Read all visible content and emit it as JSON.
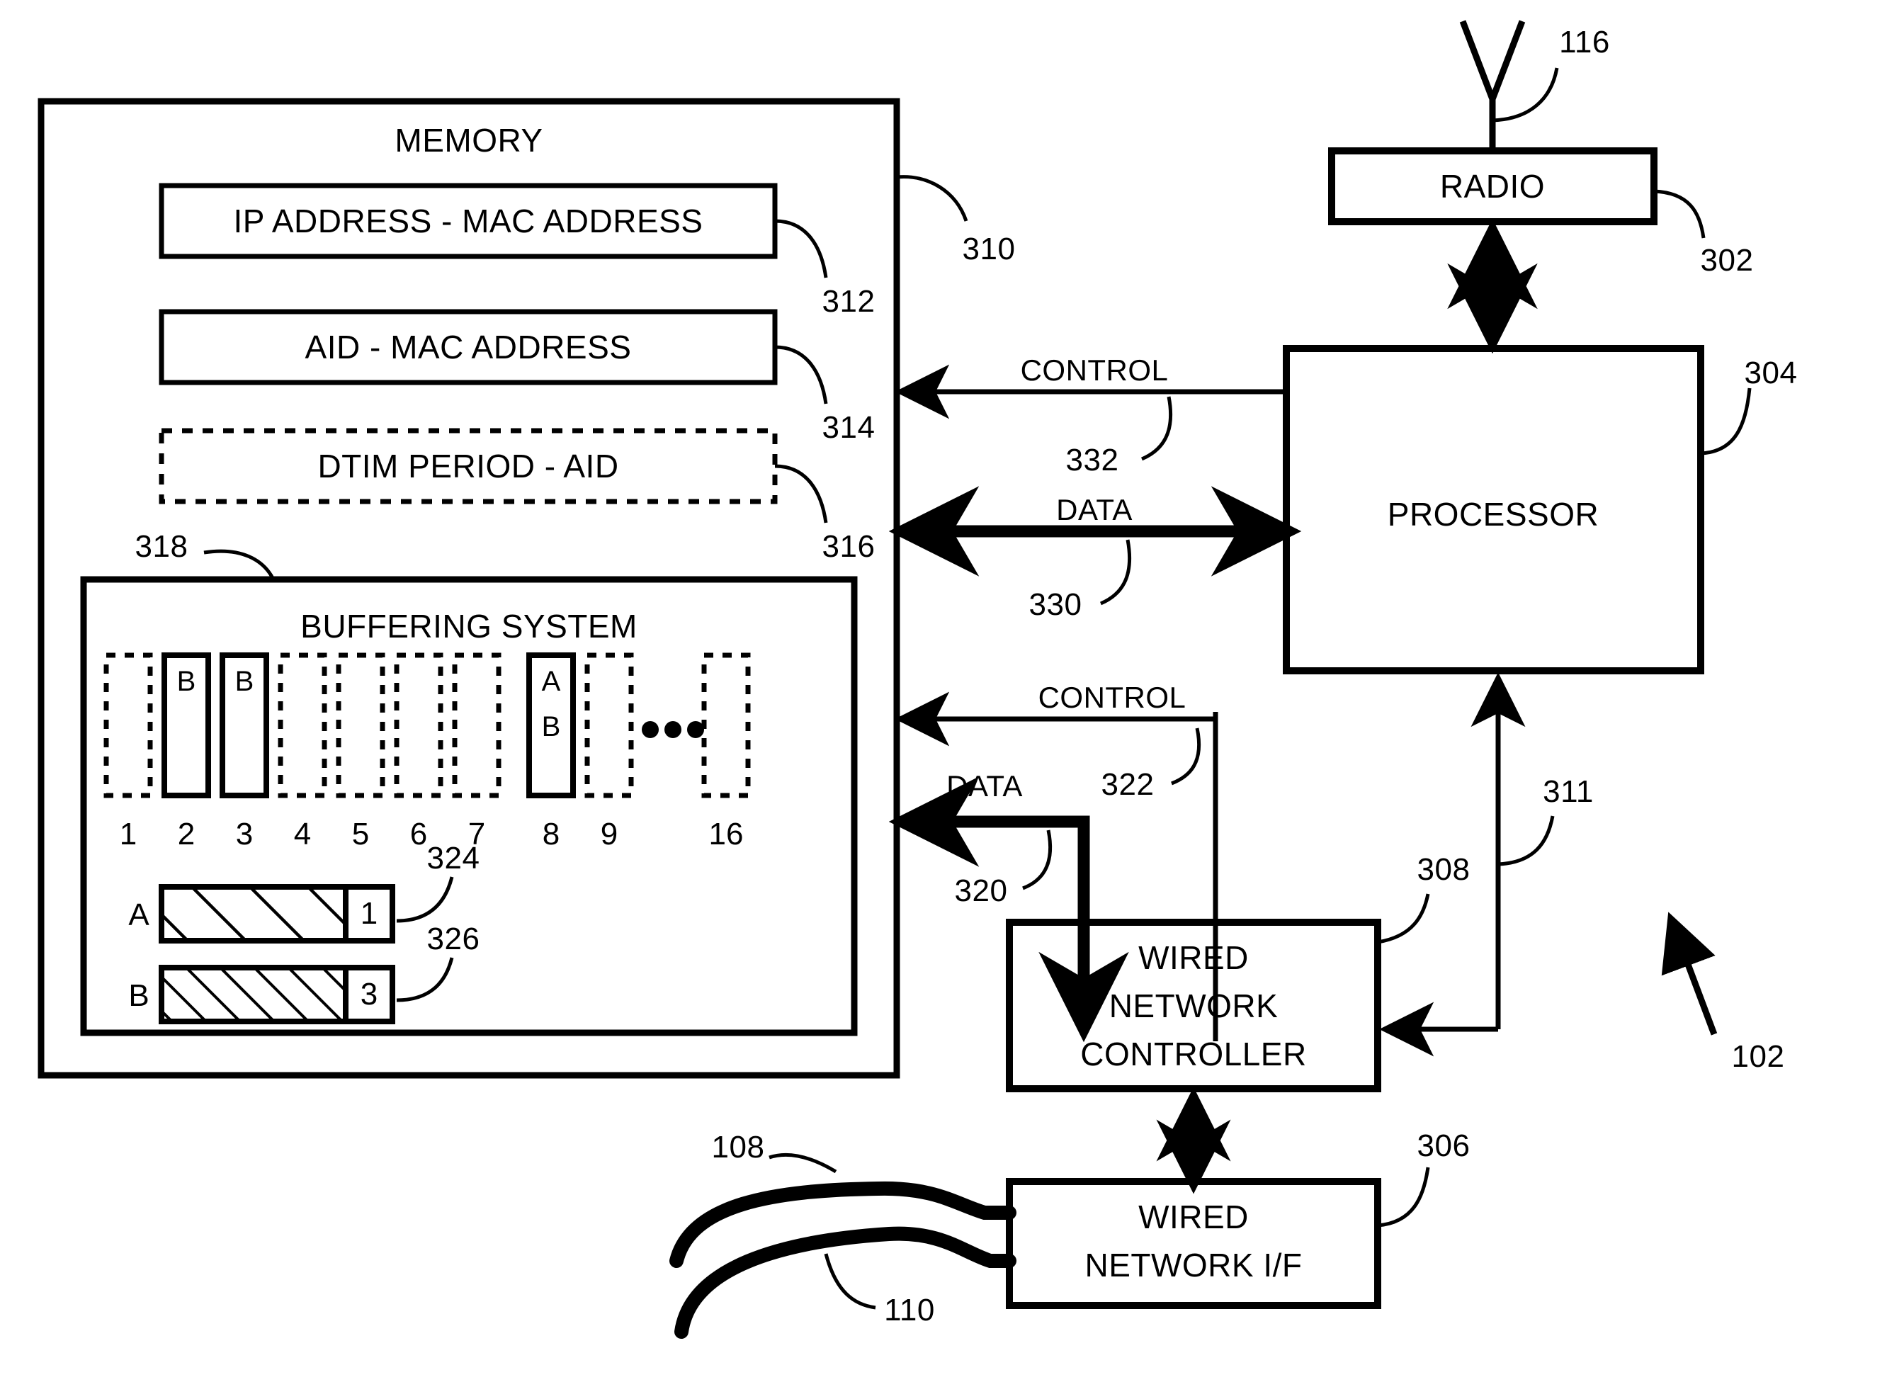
{
  "figure": {
    "overall_ref": "102"
  },
  "memory": {
    "title": "MEMORY",
    "ref": "310",
    "tables": [
      {
        "label": "IP ADDRESS - MAC ADDRESS",
        "ref": "312",
        "style": "solid"
      },
      {
        "label": "AID - MAC ADDRESS",
        "ref": "314",
        "style": "solid"
      },
      {
        "label": "DTIM PERIOD - AID",
        "ref": "316",
        "style": "dashed"
      }
    ],
    "buffering_system": {
      "title": "BUFFERING SYSTEM",
      "ref": "318",
      "ellipsis": "•••",
      "slots": [
        {
          "number": "1",
          "style": "dashed",
          "contents": []
        },
        {
          "number": "2",
          "style": "solid",
          "contents": [
            "B"
          ]
        },
        {
          "number": "3",
          "style": "solid",
          "contents": [
            "B"
          ]
        },
        {
          "number": "4",
          "style": "dashed",
          "contents": []
        },
        {
          "number": "5",
          "style": "dashed",
          "contents": []
        },
        {
          "number": "6",
          "style": "dashed",
          "contents": []
        },
        {
          "number": "7",
          "style": "dashed",
          "contents": []
        },
        {
          "number": "8",
          "style": "solid",
          "contents": [
            "A",
            "B"
          ]
        },
        {
          "number": "9",
          "style": "dashed",
          "contents": []
        },
        {
          "number": "16",
          "style": "dashed",
          "contents": []
        }
      ],
      "counters": [
        {
          "letter": "A",
          "count": "1",
          "ref": "324",
          "hatch": "wide"
        },
        {
          "letter": "B",
          "count": "3",
          "ref": "326",
          "hatch": "narrow"
        }
      ]
    }
  },
  "radio": {
    "label": "RADIO",
    "ref": "302"
  },
  "antenna": {
    "ref": "116"
  },
  "processor": {
    "label": "PROCESSOR",
    "ref": "304"
  },
  "wired_network_controller": {
    "lines": [
      "WIRED",
      "NETWORK",
      "CONTROLLER"
    ],
    "ref": "308"
  },
  "wired_network_interface": {
    "lines": [
      "WIRED",
      "NETWORK I/F"
    ],
    "ref": "306"
  },
  "cables": [
    {
      "ref": "108"
    },
    {
      "ref": "110"
    }
  ],
  "signals": [
    {
      "name": "CONTROL",
      "ref": "332",
      "from": "processor",
      "to": "memory",
      "direction": "one-way",
      "weight": "thin"
    },
    {
      "name": "DATA",
      "ref": "330",
      "from": "processor",
      "to": "memory",
      "direction": "two-way",
      "weight": "thick"
    },
    {
      "name": "CONTROL",
      "ref": "322",
      "from": "controller",
      "to": "memory",
      "direction": "one-way",
      "weight": "thin"
    },
    {
      "name": "DATA",
      "ref": "320",
      "from": "controller",
      "to": "memory",
      "direction": "two-way",
      "weight": "thick"
    },
    {
      "name": "",
      "ref": "311",
      "from": "processor",
      "to": "controller",
      "direction": "one-way",
      "weight": "thin"
    }
  ],
  "colors": {
    "ink": "#000000",
    "paper": "#ffffff"
  }
}
